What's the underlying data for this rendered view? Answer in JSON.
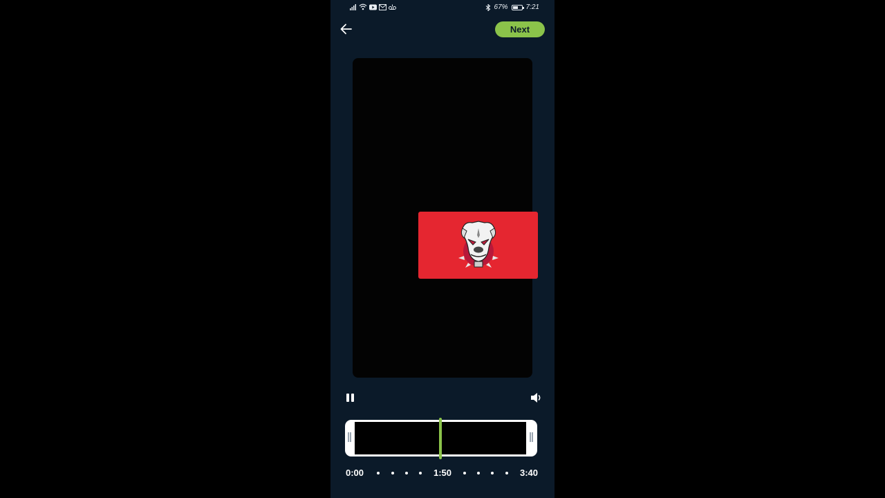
{
  "status_bar": {
    "left_icons": [
      "signal-icon",
      "wifi-icon",
      "youtube-icon",
      "mail-icon",
      "voicemail-icon"
    ],
    "bluetooth_icon": "bluetooth-icon",
    "battery_percent": "67%",
    "battery_level": 0.67,
    "time": "7:21"
  },
  "header": {
    "back_icon": "arrow-left-icon",
    "next_label": "Next",
    "accent_color": "#8bc34a"
  },
  "preview": {
    "overlay_color": "#e52630",
    "overlay_logo": "bulldog-logo"
  },
  "controls": {
    "pause_icon": "pause-icon",
    "volume_icon": "volume-icon"
  },
  "trimmer": {
    "playhead_fraction": 0.5,
    "start_label": "0:00",
    "middle_label": "1:50",
    "end_label": "3:40"
  }
}
